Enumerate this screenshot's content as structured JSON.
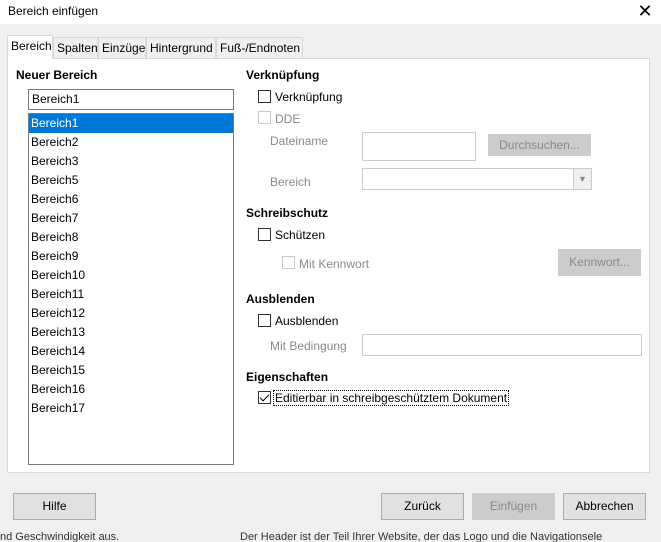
{
  "window": {
    "title": "Bereich einfügen",
    "close_glyph": "✕"
  },
  "tabs": [
    {
      "label": "Bereich"
    },
    {
      "label": "Spalten"
    },
    {
      "label": "Einzüge"
    },
    {
      "label": "Hintergrund"
    },
    {
      "label": "Fuß-/Endnoten"
    }
  ],
  "new_section": {
    "heading": "Neuer Bereich",
    "name_value": "Bereich1",
    "items": [
      "Bereich1",
      "Bereich2",
      "Bereich3",
      "Bereich5",
      "Bereich6",
      "Bereich7",
      "Bereich8",
      "Bereich9",
      "Bereich10",
      "Bereich11",
      "Bereich12",
      "Bereich13",
      "Bereich14",
      "Bereich15",
      "Bereich16",
      "Bereich17"
    ],
    "selected": "Bereich1"
  },
  "link": {
    "heading": "Verknüpfung",
    "link_checkbox": "Verknüpfung",
    "dde_checkbox": "DDE",
    "filename_label": "Dateiname",
    "filename_value": "",
    "browse_button": "Durchsuchen...",
    "section_label": "Bereich",
    "section_value": ""
  },
  "protection": {
    "heading": "Schreibschutz",
    "protect_checkbox": "Schützen",
    "password_checkbox": "Mit Kennwort",
    "password_button": "Kennwort..."
  },
  "hide": {
    "heading": "Ausblenden",
    "hide_checkbox": "Ausblenden",
    "condition_label": "Mit Bedingung",
    "condition_value": ""
  },
  "properties": {
    "heading": "Eigenschaften",
    "editable_checkbox": "Editierbar in schreibgeschütztem Dokument",
    "editable_checked": true
  },
  "footer": {
    "help": "Hilfe",
    "back": "Zurück",
    "insert": "Einfügen",
    "cancel": "Abbrechen"
  },
  "background_text": {
    "left": "nd Geschwindigkeit aus.",
    "right": "Der Header ist der Teil Ihrer Website, der das Logo und die Navigationsele"
  }
}
